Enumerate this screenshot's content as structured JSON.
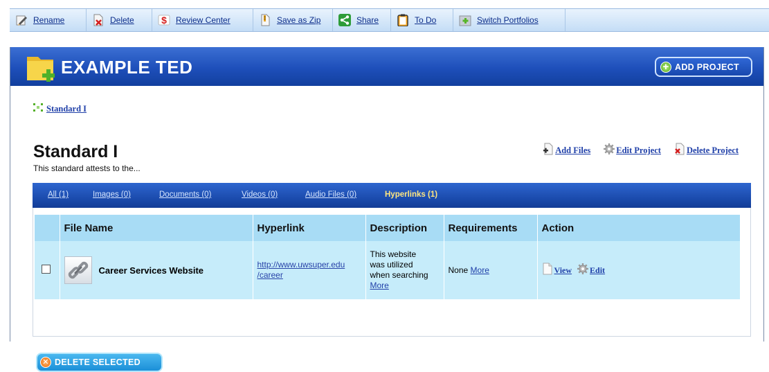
{
  "toolbar": {
    "items": [
      {
        "label": "Rename",
        "icon": "pencil-icon"
      },
      {
        "label": "Delete",
        "icon": "delete-icon"
      },
      {
        "label": "Review Center",
        "icon": "dollar-icon"
      },
      {
        "label": "Save as Zip",
        "icon": "zip-icon"
      },
      {
        "label": "Share",
        "icon": "share-icon"
      },
      {
        "label": "To Do",
        "icon": "clipboard-icon"
      },
      {
        "label": "Switch Portfolios",
        "icon": "portfolio-icon"
      }
    ]
  },
  "banner": {
    "title": "EXAMPLE TED",
    "add_project_label": "ADD PROJECT"
  },
  "breadcrumb": {
    "label": "Standard I"
  },
  "standard": {
    "title": "Standard I",
    "description": "This standard attests to the..."
  },
  "project_actions": {
    "add_files": "Add Files",
    "edit_project": "Edit Project",
    "delete_project": "Delete Project"
  },
  "tabs": [
    {
      "label": "All (1)",
      "active": false
    },
    {
      "label": "Images (0)",
      "active": false
    },
    {
      "label": "Documents (0)",
      "active": false
    },
    {
      "label": "Videos (0)",
      "active": false
    },
    {
      "label": "Audio Files (0)",
      "active": false
    },
    {
      "label": "Hyperlinks (1)",
      "active": true
    }
  ],
  "table": {
    "headers": {
      "file_name": "File Name",
      "hyperlink": "Hyperlink",
      "description": "Description",
      "requirements": "Requirements",
      "action": "Action"
    },
    "rows": [
      {
        "file_name": "Career Services Website",
        "hyperlink_line1": "http://www.uwsuper.edu",
        "hyperlink_line2": "/career",
        "description_line1": "This website",
        "description_line2": "was utilized",
        "description_line3": "when searching",
        "description_more": "More",
        "requirements": "None",
        "requirements_more": "More",
        "view_label": "View",
        "edit_label": "Edit",
        "checked": false
      }
    ]
  },
  "delete_selected_label": "DELETE SELECTED",
  "colors": {
    "banner": "#1e4fba",
    "tabbar": "#1948a9",
    "header_row": "#a8dcf5",
    "data_row": "#c6ecfa",
    "active_tab": "#ffe680"
  }
}
